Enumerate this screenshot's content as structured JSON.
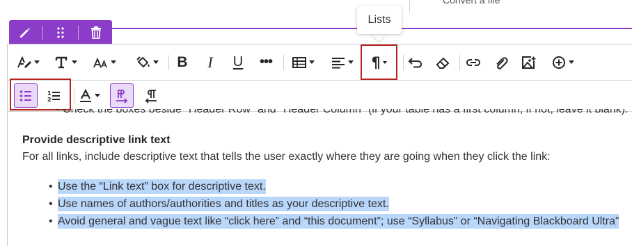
{
  "top": {
    "cut_text": "Convert a file"
  },
  "edit_tab": {
    "items": [
      "pencil-icon",
      "drag-handle-icon",
      "trash-icon"
    ]
  },
  "tooltip": {
    "text": "Lists"
  },
  "toolbar": {
    "row1": [
      "paragraph-style",
      "font-type",
      "font-size",
      "text-color",
      "bold",
      "italic",
      "underline",
      "more-formatting",
      "table",
      "alignment",
      "lists",
      "undo",
      "clear-formatting",
      "link",
      "attachment",
      "insert-image",
      "insert-content"
    ],
    "bold_label": "B",
    "italic_label": "I",
    "underline_label": "U",
    "more_label": "•••",
    "lists_label": "¶",
    "row2": [
      "bulleted-list",
      "numbered-list",
      "text-align-list",
      "ltr-direction",
      "rtl-direction"
    ]
  },
  "content": {
    "cut_line": "• Check the boxes beside \"Header Row\" and \"Header Column\" (if your table has a first column, if not, leave it blank).",
    "heading": "Provide descriptive link text",
    "paragraph": "For all links, include descriptive text that tells the user exactly where they are going when they click the link:",
    "bullets": [
      "Use the “Link text” box for descriptive text.",
      "Use names of authors/authorities and titles as your descriptive text.",
      "Avoid general and vague text like “click here” and “this document”; use “Syllabus” or “Navigating Blackboard Ultra”"
    ]
  },
  "colors": {
    "accent": "#8b3cc9",
    "highlight": "#b3261e",
    "selection": "#b9d6fb",
    "active_bg": "#ead9f7"
  }
}
